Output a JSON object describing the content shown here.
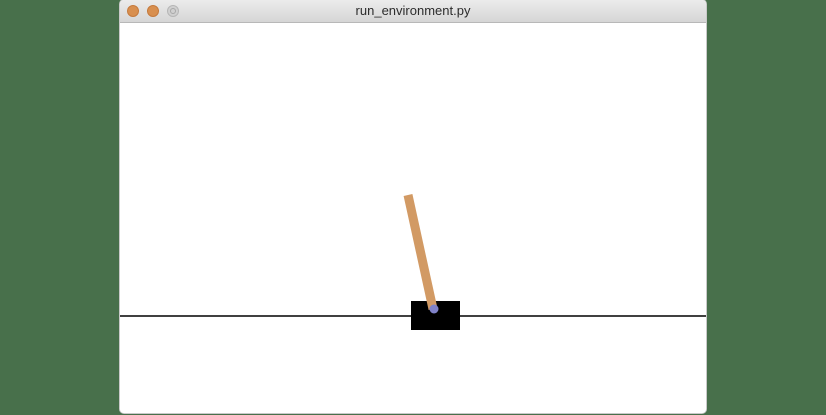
{
  "window": {
    "title": "run_environment.py",
    "controls": {
      "close_icon": "close-icon",
      "minimize_icon": "minimize-icon",
      "zoom_icon": "zoom-icon"
    }
  },
  "scene": {
    "description": "Cart-pole environment render",
    "colors": {
      "background": "#48704b",
      "canvas": "#ffffff",
      "track": "#000000",
      "cart": "#000000",
      "pole": "#d29a64",
      "axle": "#8082c8"
    }
  }
}
